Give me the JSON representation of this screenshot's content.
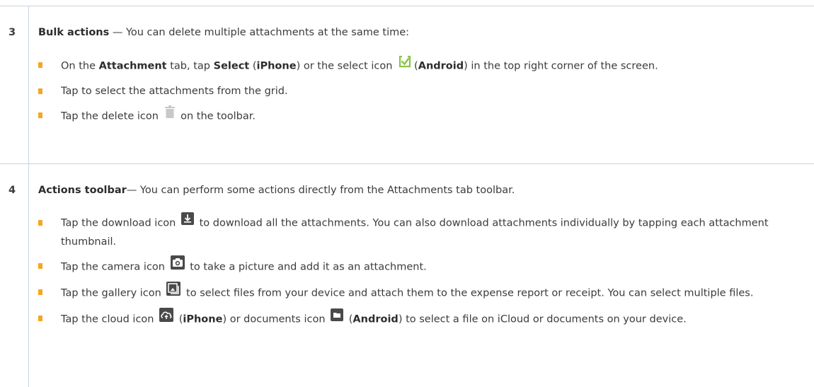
{
  "step3": {
    "number": "3",
    "title": "Bulk actions",
    "intro": " — You can delete multiple attachments at the same time:",
    "b1": {
      "t1": "On the ",
      "attachment": "Attachment",
      "t2": " tab, tap ",
      "select": "Select",
      "t3": " (",
      "iphone": "iPhone",
      "t4": ") or the select icon ",
      "t5": "(",
      "android": "Android",
      "t6": ") in the top right corner of the screen."
    },
    "b2": "Tap to select the attachments from the grid.",
    "b3": {
      "t1": "Tap the delete icon ",
      "t2": " on the toolbar."
    }
  },
  "step4": {
    "number": "4",
    "title": "Actions toolbar",
    "intro": "— You can perform some actions directly from the Attachments tab toolbar.",
    "b1": {
      "t1": "Tap the download icon ",
      "t2": " to download all the attachments. You can also download attachments individually by tapping each attachment thumbnail."
    },
    "b2": {
      "t1": "Tap the camera icon ",
      "t2": " to take a picture and add it as an attachment."
    },
    "b3": {
      "t1": "Tap the gallery icon ",
      "t2": " to select files from your device and attach them to the expense report or receipt. You can select multiple files."
    },
    "b4": {
      "t1": "Tap the cloud icon ",
      "t2": " (",
      "iphone": "iPhone",
      "t3": ") or documents icon ",
      "t4": " (",
      "android": "Android",
      "t5": ") to select a file on iCloud or documents on your device."
    }
  },
  "colors": {
    "bullet": "#f5a623",
    "border": "#c9d3e0",
    "select_icon": "#8bc34a",
    "toolbar_icon": "#4a4a4a"
  },
  "icons": [
    "select-check-icon",
    "trash-icon",
    "download-icon",
    "camera-icon",
    "gallery-icon",
    "cloud-icon",
    "documents-icon"
  ]
}
